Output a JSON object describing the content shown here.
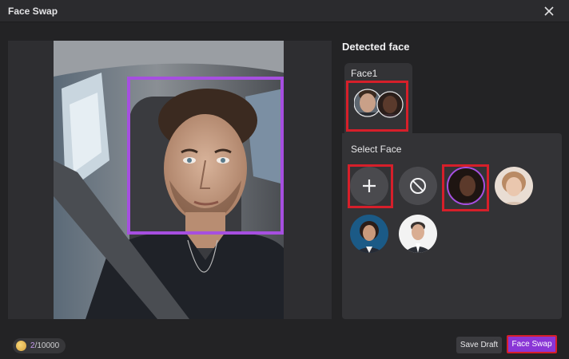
{
  "window": {
    "title": "Face Swap",
    "close_icon": "close-icon"
  },
  "preview": {
    "image": "portrait-photo-man-in-car",
    "detection_box_color": "#a64fe0"
  },
  "detected": {
    "title": "Detected face",
    "faces": [
      {
        "label": "Face1",
        "thumbnail": "face1-thumbnail"
      }
    ]
  },
  "select_face": {
    "title": "Select Face",
    "add_icon": "plus-icon",
    "none_icon": "no-symbol-icon",
    "options": [
      {
        "thumbnail": "woman-dark-hair-avatar",
        "selected": true
      },
      {
        "thumbnail": "woman-light-hair-avatar",
        "selected": false
      },
      {
        "thumbnail": "businesswoman-avatar",
        "selected": false
      },
      {
        "thumbnail": "businessman-avatar",
        "selected": false
      }
    ]
  },
  "footer": {
    "credits_used": "2",
    "credits_total": "/10000",
    "save_draft_label": "Save Draft",
    "face_swap_label": "Face Swap"
  },
  "colors": {
    "accent_purple": "#8a35d6",
    "highlight_red": "#d61f2a",
    "background": "#232325"
  }
}
